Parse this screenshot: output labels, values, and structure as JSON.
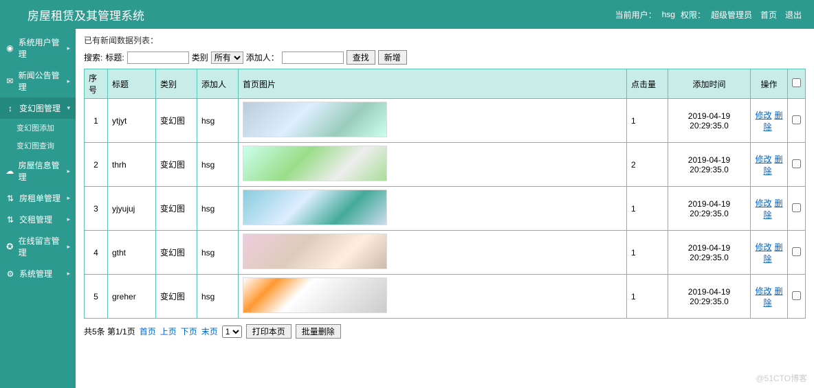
{
  "header": {
    "title": "房屋租赁及其管理系统",
    "current_user_label": "当前用户：",
    "current_user": "hsg",
    "role_label": "权限：",
    "role": "超级管理员",
    "home": "首页",
    "logout": "退出"
  },
  "sidebar": {
    "items": [
      {
        "icon": "user-icon",
        "label": "系统用户管理"
      },
      {
        "icon": "info-icon",
        "label": "新闻公告管理"
      },
      {
        "icon": "image-icon",
        "label": "变幻图管理",
        "expanded": true,
        "children": [
          "变幻图添加",
          "变幻图查询"
        ]
      },
      {
        "icon": "cloud-icon",
        "label": "房屋信息管理"
      },
      {
        "icon": "route-icon",
        "label": "房租单管理"
      },
      {
        "icon": "route-icon",
        "label": "交租管理"
      },
      {
        "icon": "msg-icon",
        "label": "在线留言管理"
      },
      {
        "icon": "gear-icon",
        "label": "系统管理"
      }
    ]
  },
  "crumb": "已有新闻数据列表：",
  "search": {
    "label": "搜索:",
    "title_label": "标题:",
    "title_value": "",
    "category_label": "类别",
    "category_value": "所有",
    "adder_label": "添加人：",
    "adder_value": "",
    "find_btn": "查找",
    "add_btn": "新增"
  },
  "columns": {
    "seq": "序号",
    "title": "标题",
    "category": "类别",
    "adder": "添加人",
    "image": "首页图片",
    "hits": "点击量",
    "addtime": "添加时间",
    "ops": "操作"
  },
  "ops": {
    "edit": "修改",
    "delete": "删除"
  },
  "rows": [
    {
      "seq": "1",
      "title": "ytjyt",
      "category": "变幻图",
      "adder": "hsg",
      "thumb": "t1",
      "hits": "1",
      "addtime": "2019-04-19 20:29:35.0"
    },
    {
      "seq": "2",
      "title": "thrh",
      "category": "变幻图",
      "adder": "hsg",
      "thumb": "t2",
      "hits": "2",
      "addtime": "2019-04-19 20:29:35.0"
    },
    {
      "seq": "3",
      "title": "yjyujuj",
      "category": "变幻图",
      "adder": "hsg",
      "thumb": "t3",
      "hits": "1",
      "addtime": "2019-04-19 20:29:35.0"
    },
    {
      "seq": "4",
      "title": "gtht",
      "category": "变幻图",
      "adder": "hsg",
      "thumb": "t4",
      "hits": "1",
      "addtime": "2019-04-19 20:29:35.0"
    },
    {
      "seq": "5",
      "title": "greher",
      "category": "变幻图",
      "adder": "hsg",
      "thumb": "t5",
      "hits": "1",
      "addtime": "2019-04-19 20:29:35.0"
    }
  ],
  "pager": {
    "summary": "共5条 第1/1页",
    "first": "首页",
    "prev": "上页",
    "next": "下页",
    "last": "末页",
    "page_value": "1",
    "print": "打印本页",
    "batch_delete": "批量删除"
  },
  "watermark": "@51CTO博客"
}
